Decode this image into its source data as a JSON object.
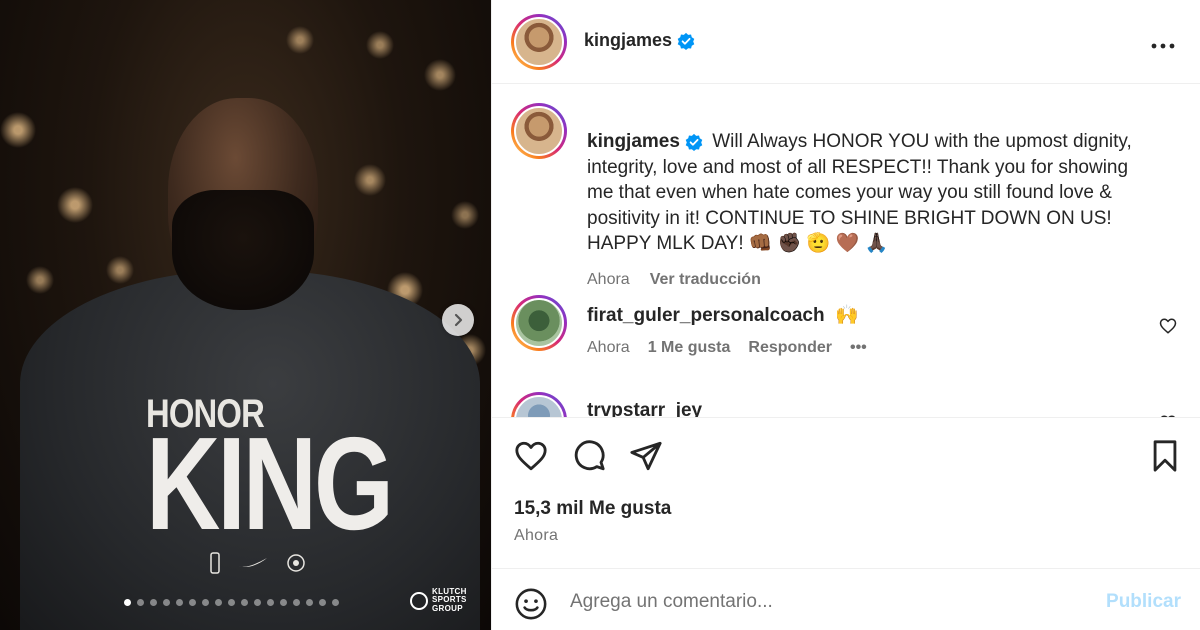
{
  "post": {
    "author": "kingjames",
    "verified_icon": "verified-badge-icon",
    "more_icon": "more-options-icon",
    "photo": {
      "shirt_line1": "HONOR",
      "shirt_line2": "KING",
      "watermark": [
        "KLUTCH",
        "SPORTS",
        "GROUP"
      ],
      "carousel_count": 17,
      "carousel_active_index": 0
    },
    "caption": {
      "username": "kingjames",
      "text": "Will Always HONOR YOU with the upmost dignity, integrity, love and most of all RESPECT!! Thank you for showing me that even when hate comes your way you still found love & positivity in it! CONTINUE TO SHINE BRIGHT DOWN ON US! HAPPY MLK DAY! 👊🏾 ✊🏿 🫡 🤎 🙏🏿",
      "time": "Ahora",
      "translate": "Ver traducción"
    },
    "comments": [
      {
        "username": "firat_guler_personalcoach",
        "text": "🙌",
        "time": "Ahora",
        "likes": "1 Me gusta",
        "reply": "Responder",
        "more": "•••"
      },
      {
        "username": "trvpstarr_jey",
        "text": "",
        "time": "",
        "likes": "",
        "reply": "",
        "more": ""
      }
    ],
    "likes_count": "15,3 mil Me gusta",
    "posted_time": "Ahora",
    "add_comment": {
      "placeholder": "Agrega un comentario...",
      "post_label": "Publicar"
    }
  },
  "colors": {
    "text": "#262626",
    "secondary": "#737373",
    "verified": "#0095f6",
    "post_button_disabled": "#b2dffc",
    "border": "#efefef"
  }
}
